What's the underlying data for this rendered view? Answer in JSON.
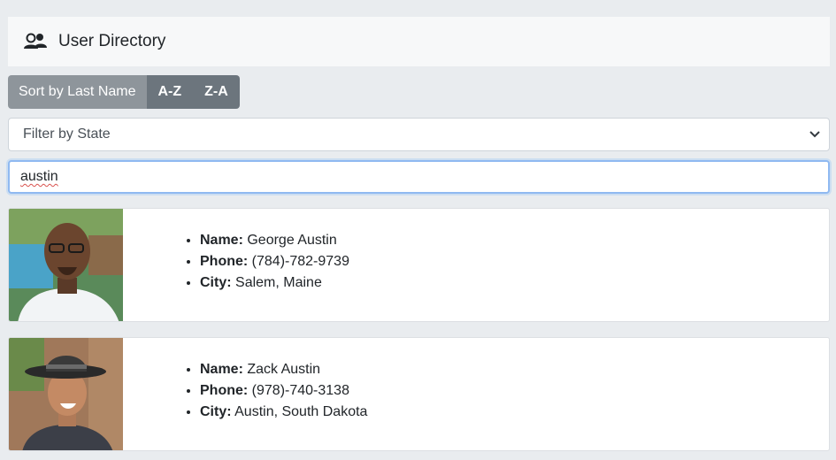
{
  "header": {
    "title": "User Directory",
    "icon": "users-icon"
  },
  "sort": {
    "label": "Sort by Last Name",
    "asc_label": "A-Z",
    "desc_label": "Z-A"
  },
  "filter": {
    "selected": "Filter by State"
  },
  "search": {
    "value": "austin"
  },
  "field_labels": {
    "name": "Name:",
    "phone": "Phone:",
    "city": "City:"
  },
  "users": [
    {
      "name": "George Austin",
      "phone": "(784)-782-9739",
      "city": "Salem, Maine"
    },
    {
      "name": "Zack Austin",
      "phone": "(978)-740-3138",
      "city": "Austin, South Dakota"
    }
  ],
  "colors": {
    "secondary": "#6c757d",
    "focus_border": "#8fb9f1",
    "background": "#e9ecef"
  }
}
